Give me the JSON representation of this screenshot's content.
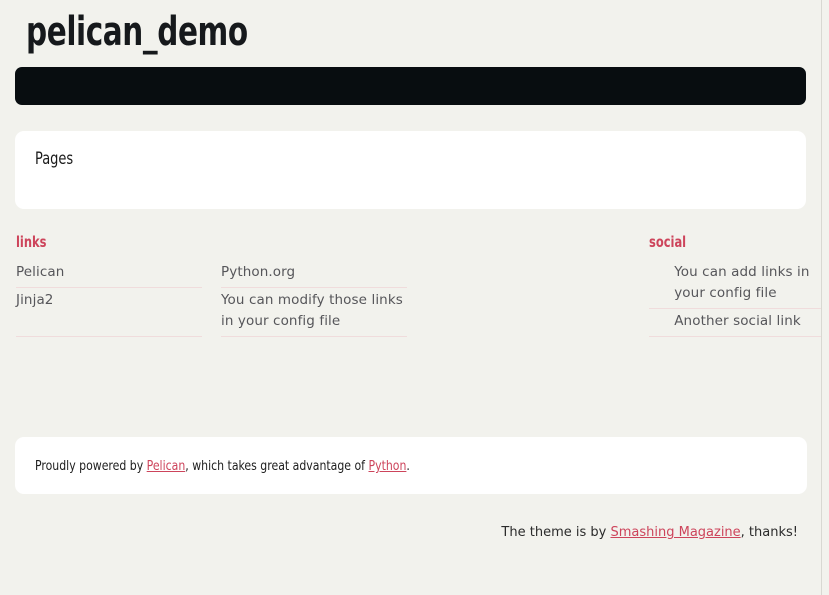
{
  "site": {
    "title": "pelican_demo",
    "background_color": "#f2f2ed",
    "accent_color": "#cd445b",
    "navbar_color": "#080d10",
    "card_color": "#ffffff"
  },
  "navbar": {
    "items": []
  },
  "pages_card": {
    "heading": "Pages",
    "items": []
  },
  "widgets": {
    "links": {
      "heading": "links",
      "items": [
        {
          "label": "Pelican"
        },
        {
          "label": "Python.org"
        },
        {
          "label": "Jinja2"
        },
        {
          "label": "You can modify those links in your config file"
        }
      ]
    },
    "social": {
      "heading": "social",
      "items": [
        {
          "label": "You can add links in your config file"
        },
        {
          "label": "Another social link"
        }
      ]
    }
  },
  "footer": {
    "prefix": "Proudly powered by ",
    "link1": "Pelican",
    "middle": ", which takes great advantage of ",
    "link2": "Python",
    "suffix": "."
  },
  "theme_credit": {
    "prefix": "The theme is by ",
    "link": "Smashing Magazine",
    "suffix": ", thanks!"
  }
}
